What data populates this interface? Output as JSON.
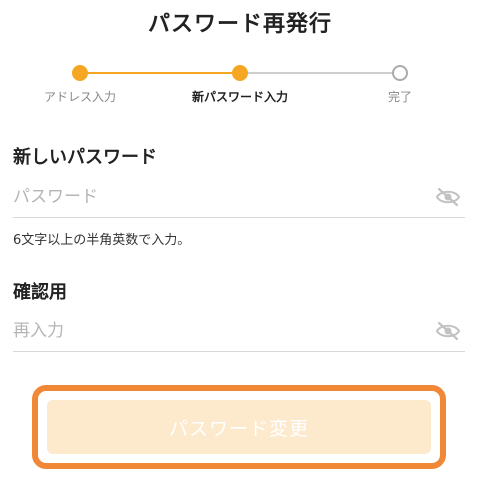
{
  "page": {
    "title": "パスワード再発行"
  },
  "stepper": {
    "steps": [
      {
        "label": "アドレス入力",
        "state": "done"
      },
      {
        "label": "新パスワード入力",
        "state": "current"
      },
      {
        "label": "完了",
        "state": "pending"
      }
    ],
    "colors": {
      "active": "#f5a623",
      "inactive": "#cfcfcf"
    }
  },
  "new_password": {
    "label": "新しいパスワード",
    "placeholder": "パスワード",
    "value": "",
    "hint": "6文字以上の半角英数で入力。",
    "visibility_icon": "eye-off-icon"
  },
  "confirm_password": {
    "label": "確認用",
    "placeholder": "再入力",
    "value": "",
    "visibility_icon": "eye-off-icon"
  },
  "submit": {
    "label": "パスワード変更",
    "state": "disabled",
    "colors": {
      "fill": "#fde9cc",
      "highlight_border": "#f08838"
    }
  }
}
